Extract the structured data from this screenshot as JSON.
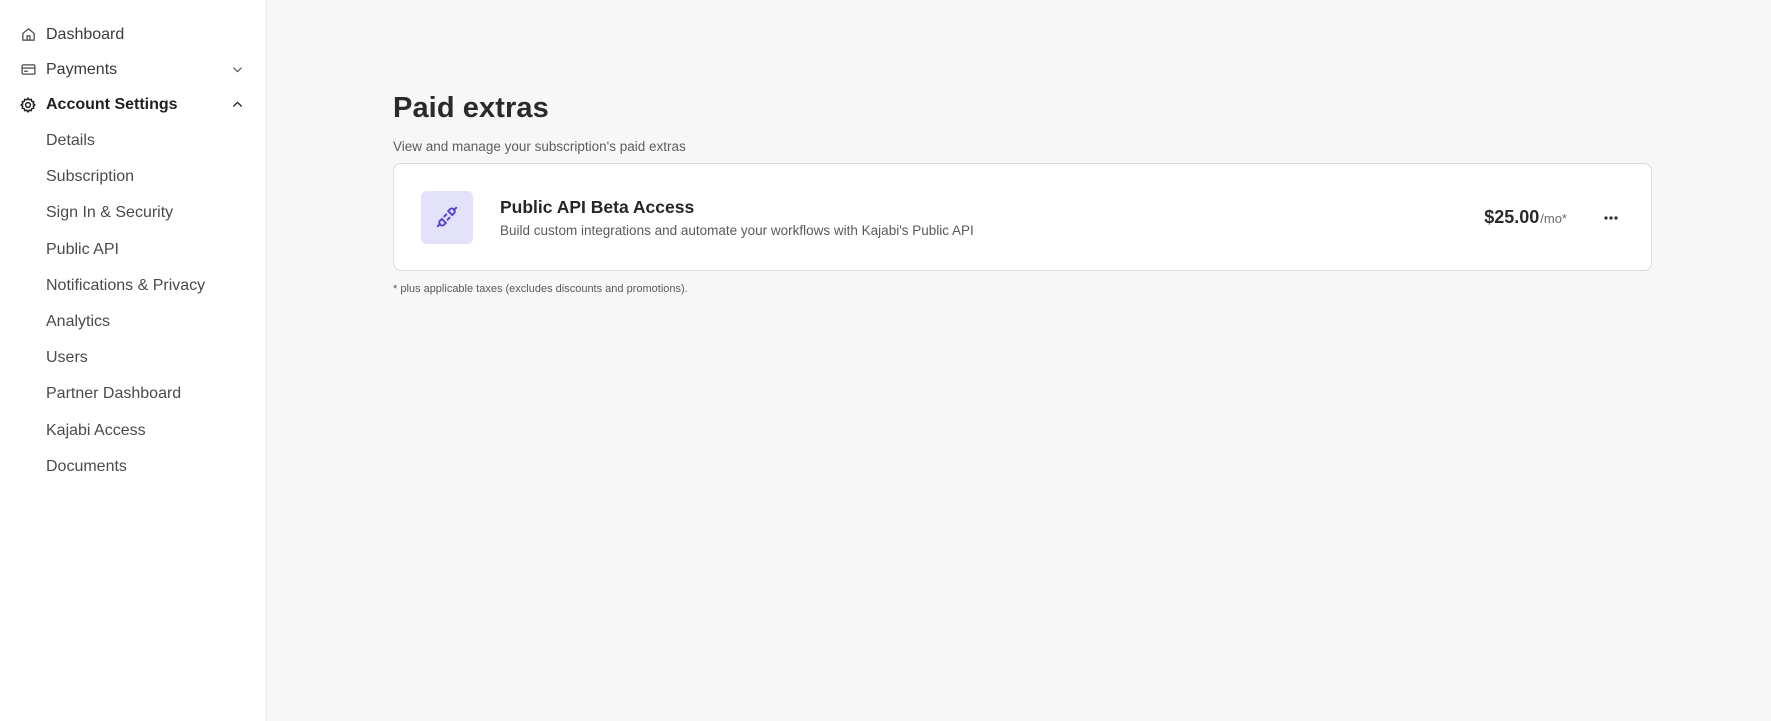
{
  "sidebar": {
    "top_items": [
      {
        "label": "Dashboard",
        "icon": "home-icon"
      },
      {
        "label": "Payments",
        "icon": "credit-card-icon",
        "chevron": "chevron-down-icon"
      },
      {
        "label": "Account Settings",
        "icon": "gear-icon",
        "chevron": "chevron-up-icon",
        "active": true
      }
    ],
    "sub_items": [
      {
        "label": "Details"
      },
      {
        "label": "Subscription"
      },
      {
        "label": "Sign In & Security"
      },
      {
        "label": "Public API"
      },
      {
        "label": "Notifications & Privacy"
      },
      {
        "label": "Analytics"
      },
      {
        "label": "Users"
      },
      {
        "label": "Partner Dashboard"
      },
      {
        "label": "Kajabi Access"
      },
      {
        "label": "Documents"
      }
    ]
  },
  "main": {
    "title": "Paid extras",
    "subtitle": "View and manage your subscription's paid extras",
    "extras": [
      {
        "icon": "plug-icon",
        "title": "Public API Beta Access",
        "description": "Build custom integrations and automate your workflows with Kajabi's Public API",
        "price": "$25.00",
        "price_unit": "/mo*"
      }
    ],
    "footnote": "* plus applicable taxes (excludes discounts and promotions)."
  },
  "colors": {
    "page_background": "#f7f7f7",
    "sidebar_background": "#ffffff",
    "icon_tile_background": "#e4e1fb",
    "icon_accent": "#5a45d6"
  }
}
